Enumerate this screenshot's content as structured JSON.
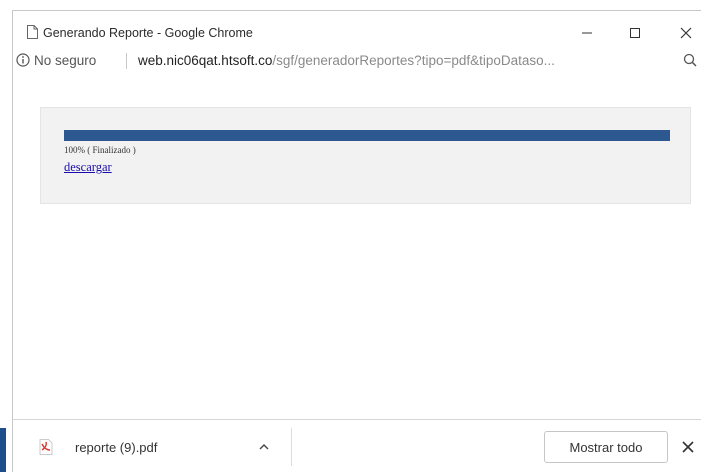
{
  "window": {
    "title": "Generando Reporte - Google Chrome"
  },
  "addressbar": {
    "security_label": "No seguro",
    "url_host": "web.nic06qat.htsoft.co",
    "url_path": "/sgf/generadorReportes?tipo=pdf&tipoDataso..."
  },
  "report": {
    "progress": 1.0,
    "status_text": "100% ( Finalizado )",
    "download_link": "descargar"
  },
  "download_shelf": {
    "file_name": "reporte (9).pdf",
    "show_all_label": "Mostrar todo"
  },
  "colors": {
    "progress_fill": "#2e5890",
    "link": "#1a0dab",
    "pdf_icon": "#d9382d"
  }
}
